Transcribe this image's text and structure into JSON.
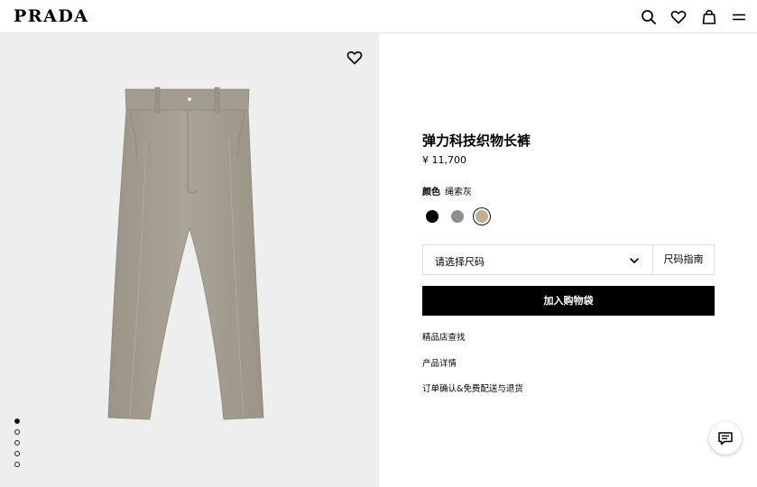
{
  "header": {
    "logo": "PRADA",
    "icons": [
      "search-icon",
      "heart-icon",
      "shopping-bag-icon",
      "menu-icon"
    ]
  },
  "gallery": {
    "image_count": 5,
    "active_index": 0
  },
  "product": {
    "title": "弹力科技织物长裤",
    "price": "¥ 11,700",
    "color_label": "颜色",
    "color_value": "绳索灰",
    "swatches": [
      {
        "name": "black",
        "color": "#000000",
        "selected": false
      },
      {
        "name": "grey",
        "color": "#8e8f93",
        "selected": false
      },
      {
        "name": "beige",
        "color": "#c4ad8a",
        "selected": true
      }
    ]
  },
  "size": {
    "select_label": "请选择尺码",
    "guide_label": "尺码指南"
  },
  "actions": {
    "add_to_bag": "加入购物袋"
  },
  "links": {
    "store_locator": "精品店查找",
    "product_details": "产品详情",
    "order_shipping": "订单确认&免费配送与退货"
  },
  "colors": {
    "brand": "#000000",
    "image_bg": "#eeeeee",
    "pants": "#a8a293"
  }
}
